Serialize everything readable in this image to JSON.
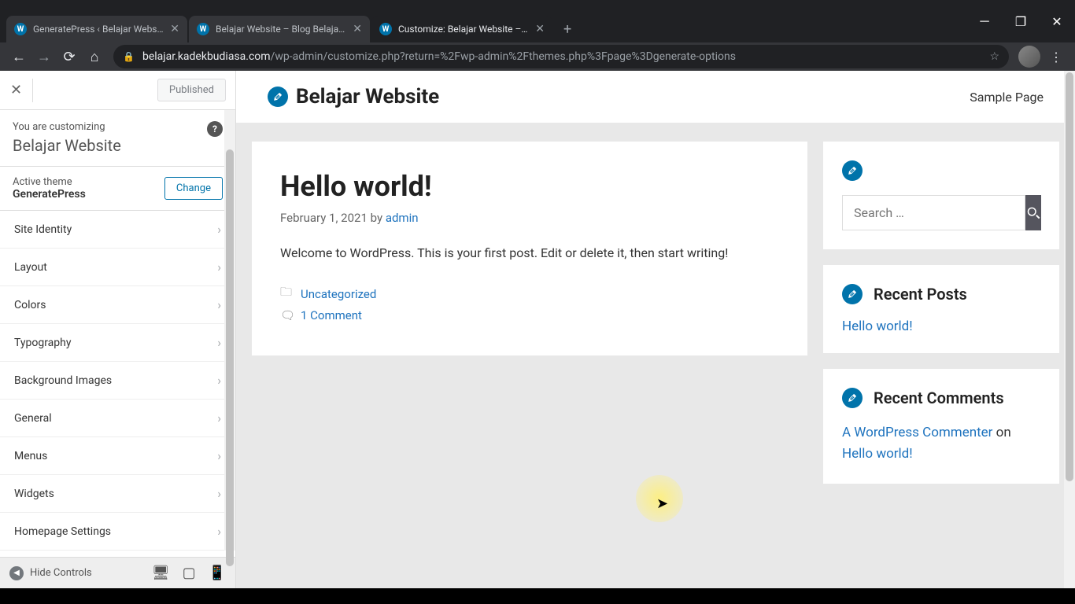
{
  "browser": {
    "tabs": [
      {
        "title": "GeneratePress ‹ Belajar Website..."
      },
      {
        "title": "Belajar Website – Blog Belajar M..."
      },
      {
        "title": "Customize: Belajar Website – Blo..."
      }
    ],
    "url_host": "belajar.kadekbudiasa.com",
    "url_path": "/wp-admin/customize.php?return=%2Fwp-admin%2Fthemes.php%3Fpage%3Dgenerate-options"
  },
  "customizer": {
    "publish_label": "Published",
    "customizing_label": "You are customizing",
    "site_name": "Belajar Website",
    "active_theme_label": "Active theme",
    "theme_name": "GeneratePress",
    "change_label": "Change",
    "menu_items": [
      "Site Identity",
      "Layout",
      "Colors",
      "Typography",
      "Background Images",
      "General",
      "Menus",
      "Widgets",
      "Homepage Settings"
    ],
    "hide_label": "Hide Controls"
  },
  "preview": {
    "site_title": "Belajar Website",
    "nav_link": "Sample Page",
    "post": {
      "title": "Hello world!",
      "date": "February 1, 2021",
      "by": "by",
      "author": "admin",
      "content": "Welcome to WordPress. This is your first post. Edit or delete it, then start writing!",
      "category": "Uncategorized",
      "comments": "1 Comment"
    },
    "search_placeholder": "Search …",
    "recent_posts_title": "Recent Posts",
    "recent_post": "Hello world!",
    "recent_comments_title": "Recent Comments",
    "commenter": "A WordPress Commenter",
    "on": "on",
    "comment_post": "Hello world!"
  }
}
